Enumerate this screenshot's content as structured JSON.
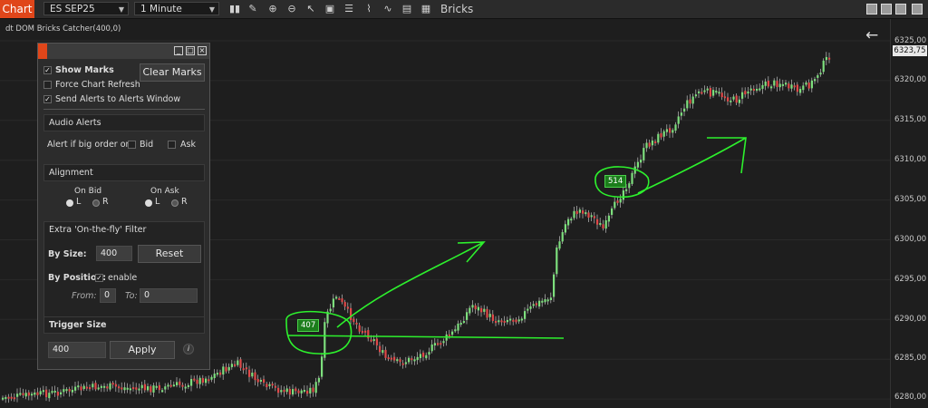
{
  "toolbar": {
    "tab_label": "Chart",
    "instrument": "ES SEP25",
    "interval": "1 Minute",
    "chart_type_label": "Bricks",
    "icons": [
      "bar-chart-icon",
      "pencil-icon",
      "zoom-in-icon",
      "zoom-out-icon",
      "cursor-icon",
      "data-box-icon",
      "properties-icon",
      "indicators-icon",
      "strategies-icon",
      "templates-icon"
    ]
  },
  "indicator_title": "dt DOM Bricks Catcher(400,0)",
  "price_axis": {
    "ticks": [
      "6325,00",
      "6320,00",
      "6315,00",
      "6310,00",
      "6305,00",
      "6300,00",
      "6295,00",
      "6290,00",
      "6285,00",
      "6280,00"
    ],
    "last_price": "6323,75"
  },
  "volume_badges": [
    "514",
    "407"
  ],
  "panel": {
    "show_marks": "Show Marks",
    "force_refresh": "Force Chart Refresh",
    "send_alerts": "Send Alerts to Alerts Window",
    "clear_marks": "Clear Marks",
    "audio_alerts": "Audio Alerts",
    "alert_if": "Alert if big order on:",
    "bid": "Bid",
    "ask": "Ask",
    "alignment": "Alignment",
    "on_bid": "On Bid",
    "on_ask": "On Ask",
    "l": "L",
    "r": "R",
    "filter_title": "Extra 'On-the-fly' Filter",
    "by_size": "By Size:",
    "size_value": "400",
    "reset": "Reset",
    "by_position": "By Position:",
    "enable": "enable",
    "from": "From:",
    "from_value": "0",
    "to": "To:",
    "to_value": "0",
    "trigger_size": "Trigger Size",
    "trigger_value": "400",
    "apply": "Apply",
    "info": "i"
  }
}
